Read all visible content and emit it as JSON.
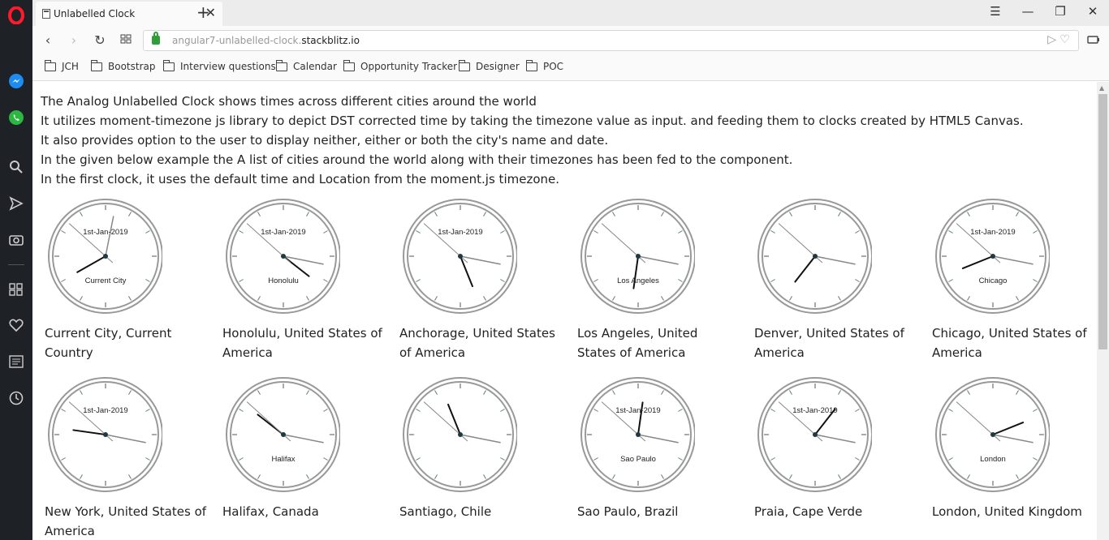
{
  "browser": {
    "tab_title": "Unlabelled Clock",
    "url_prefix": "angular7-unlabelled-clock.",
    "url_domain": "stackblitz.io",
    "bookmarks": [
      "JCH",
      "Bootstrap",
      "Interview questions",
      "Calendar",
      "Opportunity Tracker",
      "Designer",
      "POC"
    ]
  },
  "page": {
    "lines": [
      "The Analog Unlabelled Clock shows times across different cities around the world",
      "It utilizes moment-timezone js library to depict DST corrected time by taking the timezone value as input. and feeding them to clocks created by HTML5 Canvas.",
      "It also provides option to the user to display neither, either or both the city's name and date.",
      "In the given below example the A list of cities around the world along with their timezones has been fed to the component.",
      "In the first clock, it uses the default time and Location from the moment.js timezone."
    ]
  },
  "clocks": [
    {
      "date": "1st-Jan-2019",
      "city": "Current City",
      "label": "Current City, Current Country",
      "time": "8:01:52"
    },
    {
      "date": "1st-Jan-2019",
      "city": "Honolulu",
      "label": "Honolulu, United States of America",
      "time": "4:16:52"
    },
    {
      "date": "1st-Jan-2019",
      "city": "",
      "label": "Anchorage, United States of America",
      "time": "5:16:52"
    },
    {
      "date": "",
      "city": "Los Angeles",
      "label": "Los Angeles, United States of America",
      "time": "6:16:52"
    },
    {
      "date": "",
      "city": "",
      "label": "Denver, United States of America",
      "time": "7:16:52"
    },
    {
      "date": "1st-Jan-2019",
      "city": "Chicago",
      "label": "Chicago, United States of America",
      "time": "8:16:52"
    },
    {
      "date": "1st-Jan-2019",
      "city": "",
      "label": "New York, United States of America",
      "time": "9:16:52"
    },
    {
      "date": "",
      "city": "Halifax",
      "label": "Halifax, Canada",
      "time": "10:16:52"
    },
    {
      "date": "",
      "city": "",
      "label": "Santiago, Chile",
      "time": "11:16:52"
    },
    {
      "date": "1st-Jan-2019",
      "city": "Sao Paulo",
      "label": "Sao Paulo, Brazil",
      "time": "12:16:52"
    },
    {
      "date": "1st-Jan-2019",
      "city": "",
      "label": "Praia, Cape Verde",
      "time": "1:16:52"
    },
    {
      "date": "",
      "city": "London",
      "label": "London, United Kingdom",
      "time": "2:16:52"
    }
  ]
}
